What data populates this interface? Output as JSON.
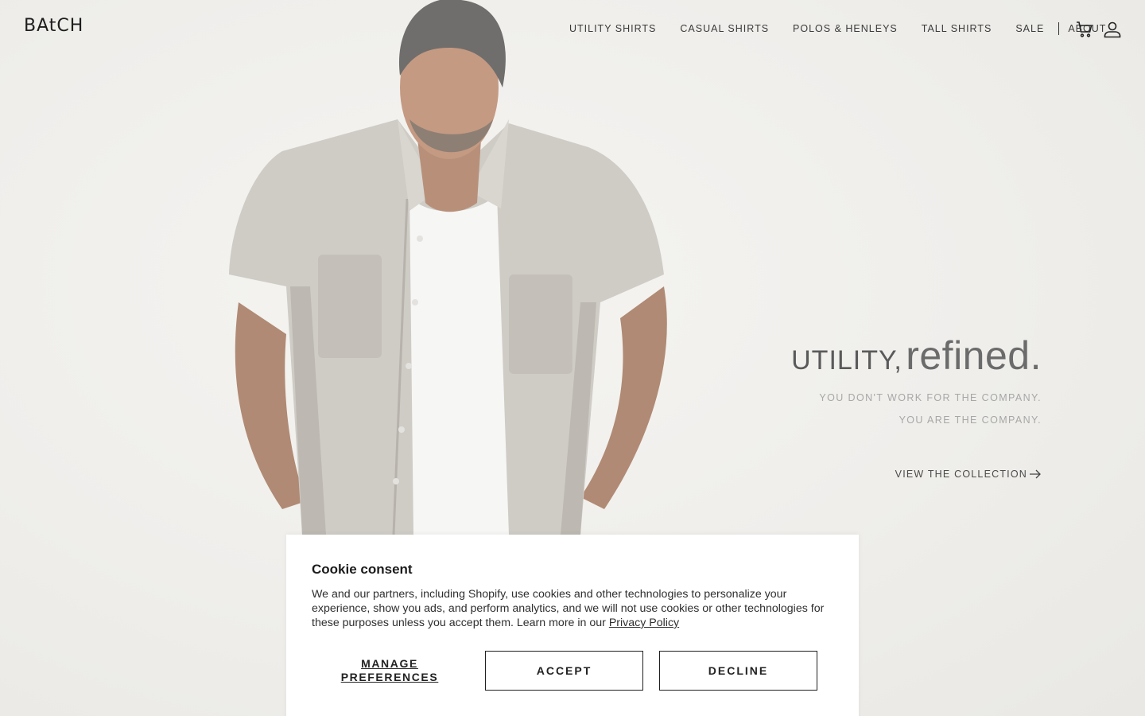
{
  "header": {
    "logo": "BAtCH",
    "nav": [
      "UTILITY SHIRTS",
      "CASUAL SHIRTS",
      "POLOS & HENLEYS",
      "TALL SHIRTS",
      "SALE",
      "ABOUT"
    ],
    "icons": [
      "cart-icon",
      "account-icon"
    ]
  },
  "hero": {
    "headline_small": "UTILITY,",
    "headline_big": "refined.",
    "tagline_1": "YOU DON'T WORK FOR THE COMPANY.",
    "tagline_2": "YOU ARE THE COMPANY.",
    "cta": "VIEW THE COLLECTION"
  },
  "cookie": {
    "title": "Cookie consent",
    "text": "We and our partners, including Shopify, use cookies and other technologies to personalize your experience, show you ads, and perform analytics, and we will not use cookies or other technologies for these purposes unless you accept them. Learn more in our ",
    "link": "Privacy Policy",
    "manage_line1": "MANAGE",
    "manage_line2": "PREFERENCES",
    "accept": "ACCEPT",
    "decline": "DECLINE"
  }
}
